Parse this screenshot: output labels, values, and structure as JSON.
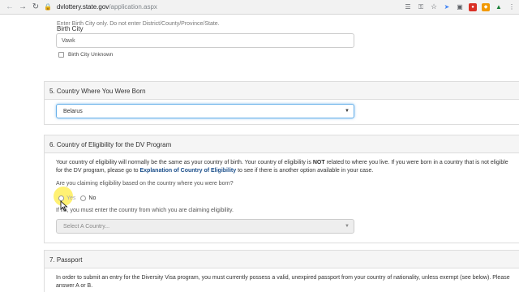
{
  "browser": {
    "url_domain": "dvlottery.state.gov",
    "url_path": "/application.aspx"
  },
  "top_text": "Enter Birth City only. Do not enter District/County/Province/State.",
  "birth_city": {
    "label": "Birth City",
    "value": "Vawk",
    "unknown_label": "Birth City Unknown"
  },
  "section5": {
    "title": "5. Country Where You Were Born",
    "selected": "Belarus"
  },
  "section6": {
    "title": "6. Country of Eligibility for the DV Program",
    "para_a": "Your country of eligibility will normally be the same as your country of birth. Your country of eligibility is ",
    "para_not": "NOT",
    "para_b": " related to where you live. If you were born in a country that is not eligible for the DV program, please go to ",
    "para_link": "Explanation of Country of Eligibility",
    "para_c": " to see if there is another option available in your case.",
    "question": "Are you claiming eligibility based on the country where you were born?",
    "yes_label": "Yes",
    "no_label": "No",
    "if_no_text": "If no, you must enter the country from which you are claiming eligibility.",
    "country_select": "Select A Country..."
  },
  "section7": {
    "title": "7. Passport",
    "para": "In order to submit an entry for the Diversity Visa program, you must currently possess a valid, unexpired passport from your country of nationality, unless exempt (see below). Please answer A or B."
  }
}
